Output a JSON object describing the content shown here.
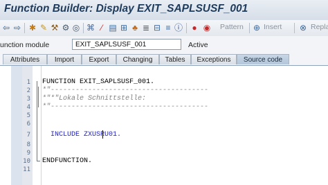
{
  "window": {
    "title": "Function Builder: Display EXIT_SAPLSUSF_001"
  },
  "toolbar": {
    "icons": [
      "back-arrow-icon",
      "forward-arrow-icon",
      "other-object-icon",
      "display-change-icon",
      "activate-icon",
      "check-icon",
      "test-icon",
      "where-used-icon",
      "display-object-list-icon",
      "navigation-icon",
      "hierarchy-icon",
      "enhance-icon",
      "display-list-icon",
      "info-icon",
      "breakpoint-icon",
      "session-breakpoint-icon",
      "pattern-icon",
      "insert-icon",
      "replace-icon"
    ],
    "pattern_label": "Pattern",
    "insert_label": "Insert",
    "replace_label": "Replace"
  },
  "header": {
    "function_module_label": "unction module",
    "function_module_value": "EXIT_SAPLSUSF_001",
    "status": "Active"
  },
  "tabs": [
    {
      "label": "Attributes"
    },
    {
      "label": "Import"
    },
    {
      "label": "Export"
    },
    {
      "label": "Changing"
    },
    {
      "label": "Tables"
    },
    {
      "label": "Exceptions"
    },
    {
      "label": "Source code",
      "active": true
    }
  ],
  "editor": {
    "lines": [
      {
        "num": "1",
        "text": "FUNCTION EXIT_SAPLSUSF_001.",
        "style": "code"
      },
      {
        "num": "2",
        "text": "*\"--------------------------------------",
        "style": "comment"
      },
      {
        "num": "3",
        "text": "*\"*\"Lokale Schnittstelle:",
        "style": "comment"
      },
      {
        "num": "4",
        "text": "*\"--------------------------------------",
        "style": "comment"
      },
      {
        "num": "5",
        "text": "",
        "style": "code"
      },
      {
        "num": "6",
        "text": "",
        "style": "code"
      },
      {
        "num": "7",
        "text": "  INCLUDE ZXUSRU01.",
        "style": "kw"
      },
      {
        "num": "8",
        "text": "",
        "style": "code"
      },
      {
        "num": "9",
        "text": "",
        "style": "code"
      },
      {
        "num": "10",
        "text": "ENDFUNCTION.",
        "style": "code"
      },
      {
        "num": "11",
        "text": "",
        "style": "code"
      }
    ]
  }
}
